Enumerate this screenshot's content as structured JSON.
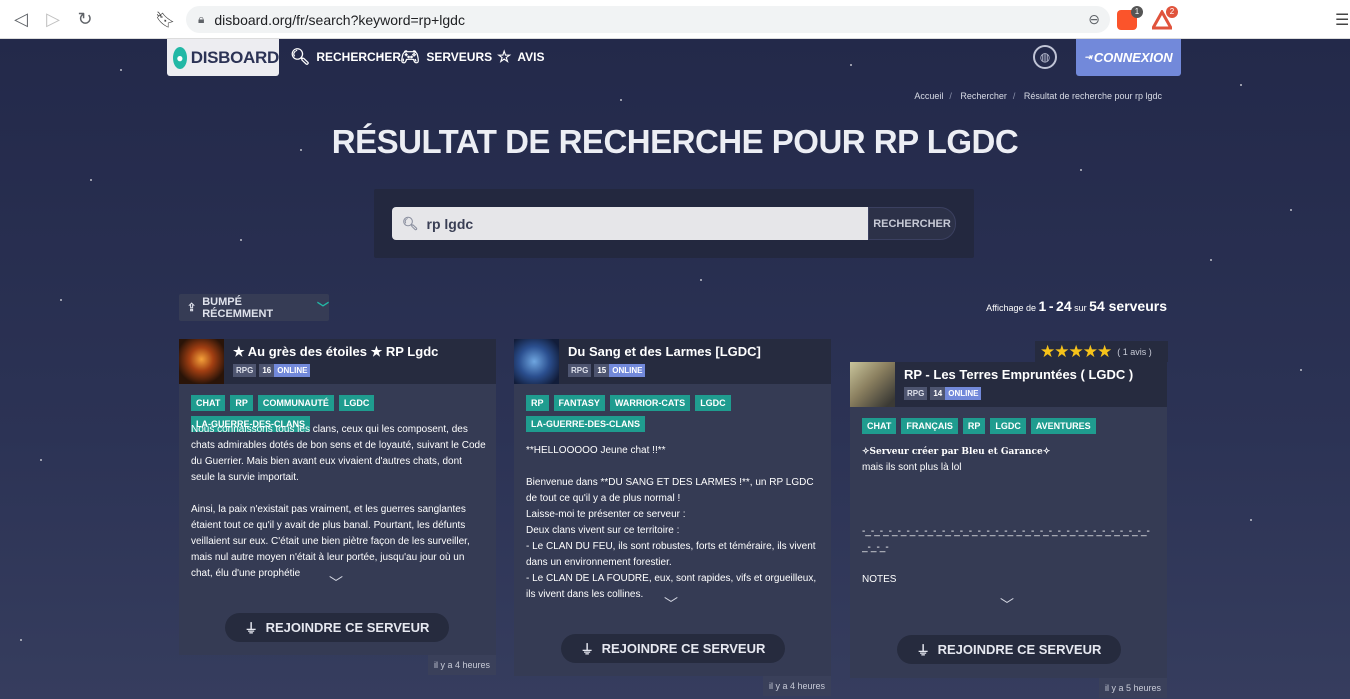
{
  "browser": {
    "url": "disboard.org/fr/search?keyword=rp+lgdc",
    "brave_badge": "1",
    "alert_badge": "2"
  },
  "nav": {
    "logo": "DISBOARD",
    "search": "RECHERCHER",
    "servers": "SERVEURS",
    "reviews": "AVIS",
    "login": "CONNEXION"
  },
  "breadcrumb": [
    "Accueil",
    "Rechercher",
    "Résultat de recherche pour rp lgdc"
  ],
  "title": "RÉSULTAT DE RECHERCHE POUR RP LGDC",
  "search": {
    "value": "rp lgdc",
    "button": "RECHERCHER"
  },
  "sort": {
    "label": "BUMPÉ RÉCEMMENT"
  },
  "results": {
    "prefix": "Affichage de",
    "from": "1",
    "dash": "-",
    "to": "24",
    "sur": "sur",
    "total": "54 serveurs"
  },
  "cards": [
    {
      "name": "★ Au grès des étoiles ★ RP Lgdc",
      "category": "RPG",
      "online_count": "16",
      "online_label": "ONLINE",
      "tags": [
        "CHAT",
        "RP",
        "COMMUNAUTÉ",
        "LGDC",
        "LA-GUERRE-DES-CLANS"
      ],
      "description": "Nous connaissons tous les clans, ceux qui les composent, des chats admirables dotés de bon sens et de loyauté, suivant le Code du Guerrier. Mais bien avant eux vivaient d'autres chats, dont seule la survie importait.\n\nAinsi, la paix n'existait pas vraiment, et les guerres sanglantes étaient tout ce qu'il y avait de plus banal. Pourtant, les défunts veillaient sur eux. C'était une bien piètre façon de les surveiller, mais nul autre moyen n'était à leur portée, jusqu'au jour où un chat, élu d'une prophétie",
      "join": "REJOINDRE CE SERVEUR",
      "time": "il y a 4 heures"
    },
    {
      "name": "Du Sang et des Larmes [LGDC]",
      "category": "RPG",
      "online_count": "15",
      "online_label": "ONLINE",
      "tags": [
        "RP",
        "FANTASY",
        "WARRIOR-CATS",
        "LGDC",
        "LA-GUERRE-DES-CLANS"
      ],
      "description": "**HELLOOOOO Jeune chat !!**\n\nBienvenue dans **DU SANG ET DES LARMES !**, un RP LGDC de tout ce qu'il y a de plus normal !\nLaisse-moi te présenter ce serveur :\nDeux clans vivent sur ce territoire :\n- Le CLAN DU FEU, ils sont robustes, forts et téméraire, ils vivent dans un environnement forestier.\n- Le CLAN DE LA FOUDRE, eux, sont rapides, vifs et orgueilleux, ils vivent dans les collines.",
      "join": "REJOINDRE CE SERVEUR",
      "time": "il y a 4 heures"
    },
    {
      "name": "RP - Les Terres Empruntées ( LGDC )",
      "category": "RPG",
      "online_count": "14",
      "online_label": "ONLINE",
      "tags": [
        "CHAT",
        "FRANÇAIS",
        "RP",
        "LGDC",
        "AVENTURES"
      ],
      "rating_stars": "★★★★★",
      "rating_count": "( 1 avis )",
      "description_special": "✧Serveur créer par Bleu et Garance✧",
      "description": "mais ils sont plus là lol\n\n\n\n-_-_-_-_-_-_-_-_-_-_-_-_-_-_-_-_-_-_-_-_-_-_-_-_-_-_-_-_-_-_-_-_-_-_-_-\n\nNOTES",
      "join": "REJOINDRE CE SERVEUR",
      "time": "il y a 5 heures"
    }
  ],
  "colors": {
    "accent": "#7289da",
    "tag": "#1f9c8f",
    "background": "#2b3251"
  }
}
